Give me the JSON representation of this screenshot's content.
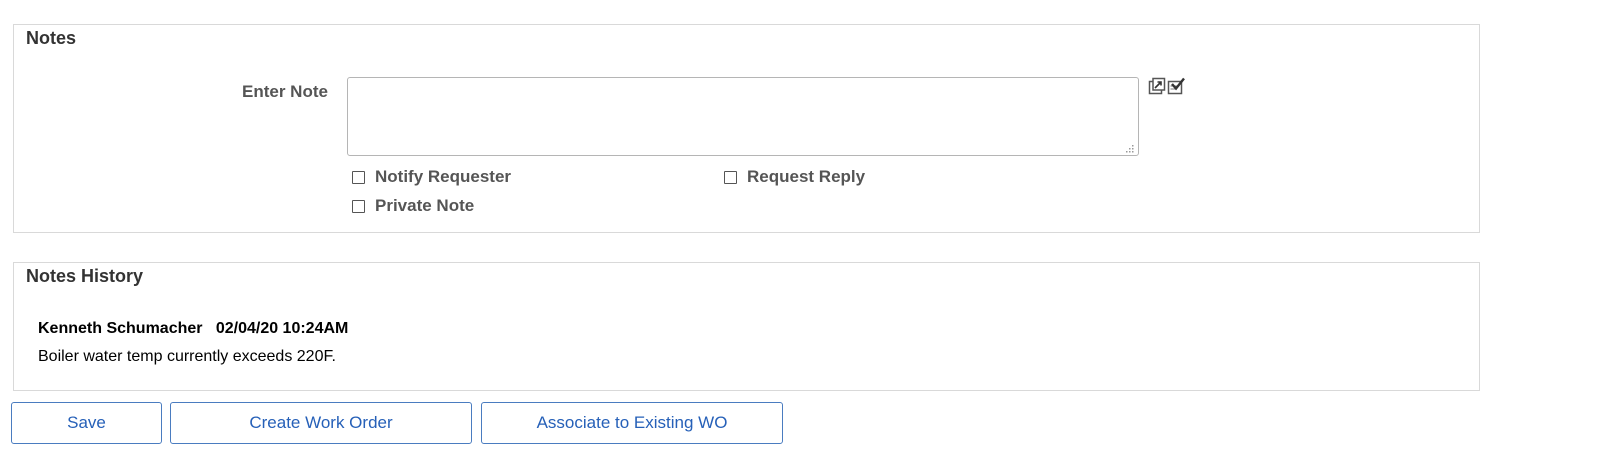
{
  "notes": {
    "title": "Notes",
    "enter_note_label": "Enter Note",
    "enter_note_value": "",
    "checkboxes": {
      "notify_requester": {
        "label": "Notify Requester",
        "checked": false
      },
      "request_reply": {
        "label": "Request Reply",
        "checked": false
      },
      "private_note": {
        "label": "Private Note",
        "checked": false
      }
    },
    "icons": [
      "expand-icon",
      "spell-check-icon"
    ]
  },
  "history": {
    "title": "Notes History",
    "entries": [
      {
        "author": "Kenneth Schumacher",
        "timestamp": "02/04/20 10:24AM",
        "text": "Boiler water temp currently exceeds 220F."
      }
    ]
  },
  "actions": {
    "save_label": "Save",
    "create_wo_label": "Create Work Order",
    "associate_label": "Associate to Existing WO"
  },
  "colors": {
    "button_text": "#2660b8",
    "button_border": "#4a7cc0",
    "panel_border": "#d9d9d9"
  }
}
